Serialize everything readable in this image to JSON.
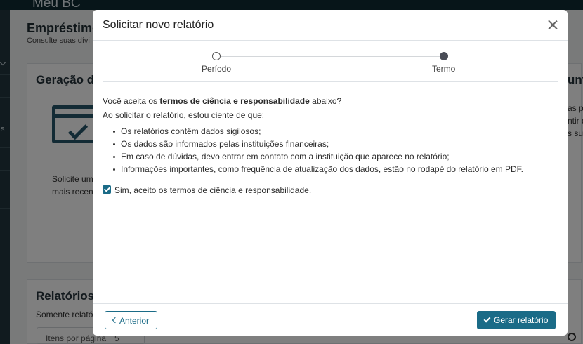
{
  "background": {
    "app_title": "Meu BC",
    "page_title": "Empréstimos",
    "page_subtitle": "Consulte suas dívi",
    "nav_letter": "s",
    "card1_title": "Geração de",
    "card1_text_line1": "Solicite um",
    "card1_text_line2": "mais recen",
    "card1_right_title": "unt",
    "card1_right_line1": "as p",
    "card1_right_line2": "ntir d",
    "card1_right_line3": "s sua",
    "card2_title": "Relatórios",
    "card2_subtitle": "Somente relató",
    "pager_label": "Itens por página",
    "pager_value": "5"
  },
  "modal": {
    "title": "Solicitar novo relatório",
    "steps": [
      {
        "label": "Período",
        "state": "completed"
      },
      {
        "label": "Termo",
        "state": "active"
      }
    ],
    "question_prefix": "Você aceita os ",
    "question_bold": "termos de ciência e responsabilidade",
    "question_suffix": " abaixo?",
    "intro": "Ao solicitar o relatório, estou ciente de que:",
    "terms": [
      "Os relatórios contêm dados sigilosos;",
      "Os dados são informados pelas instituições financeiras;",
      "Em caso de dúvidas, devo entrar em contato com a instituição que aparece no relatório;",
      "Informações importantes, como frequência de atualização dos dados, estão no rodapé do relatório em PDF."
    ],
    "accept_label": "Sim, aceito os termos de ciência e responsabilidade.",
    "accept_checked": true,
    "prev_button": "Anterior",
    "generate_button": "Gerar relatório"
  },
  "colors": {
    "primary": "#1a6b87",
    "topbar": "#0f2a33",
    "icon_dark": "#27566a"
  }
}
